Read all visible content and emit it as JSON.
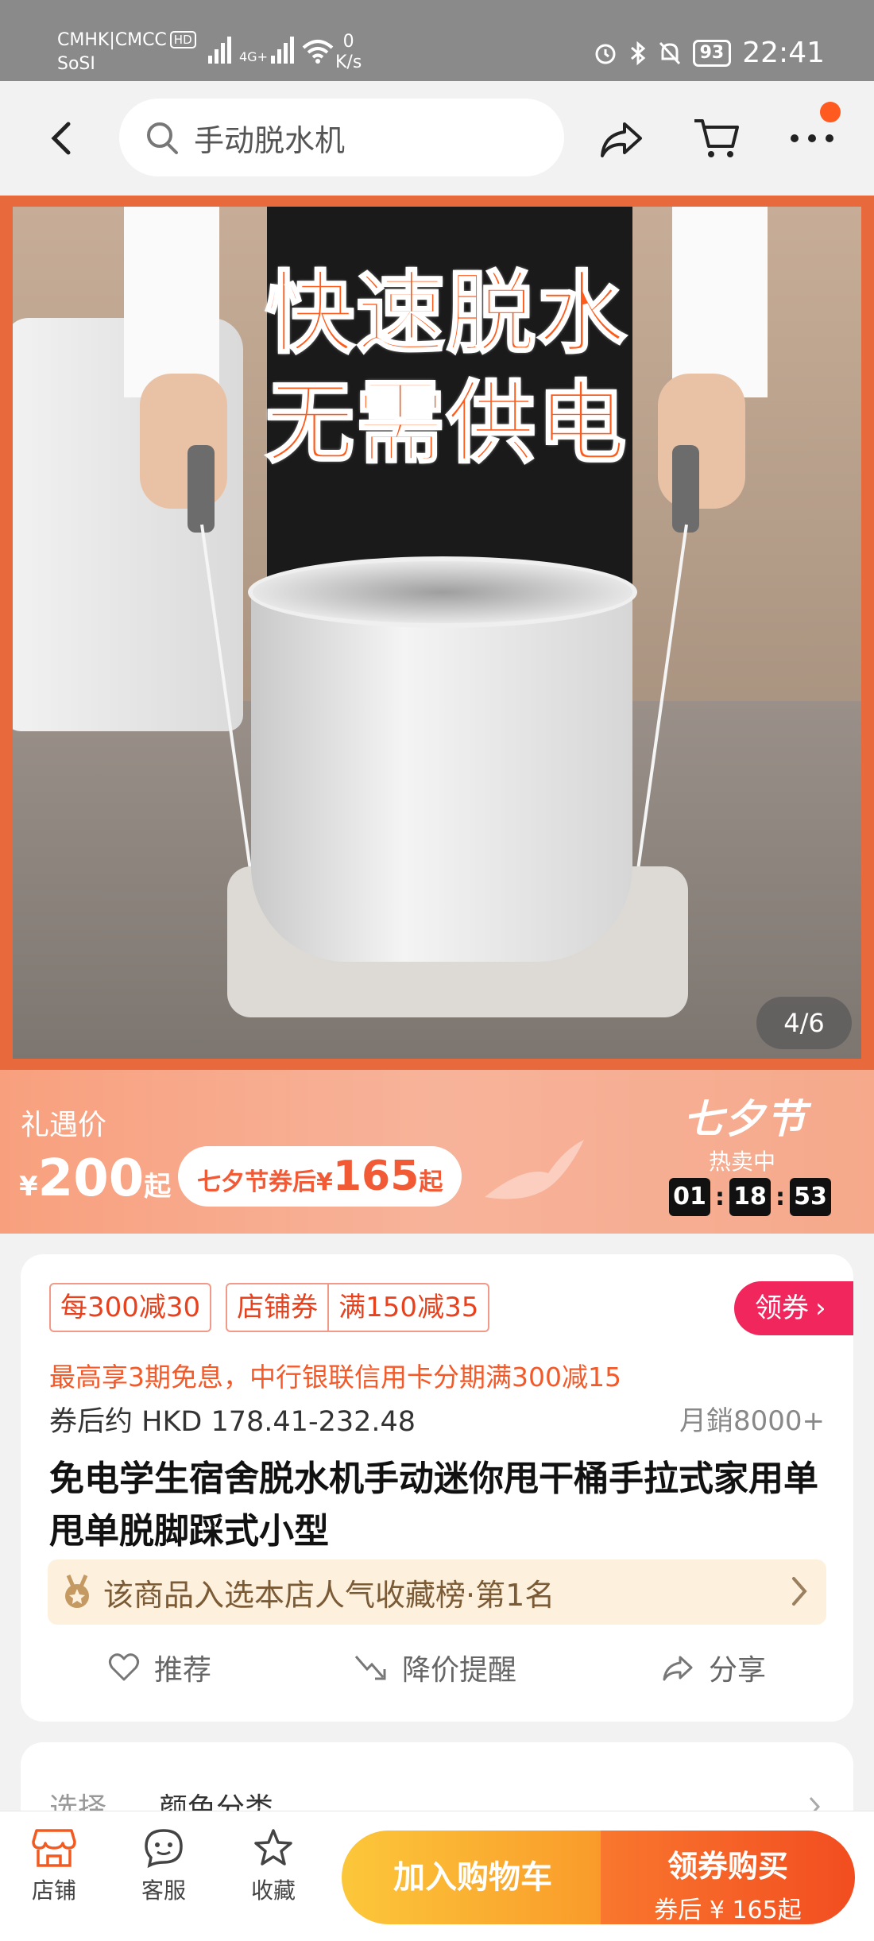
{
  "status_bar": {
    "carrier": "CMHK|CMCC",
    "hd_badge": "HD",
    "carrier2": "SoSI",
    "network": "4G+",
    "speed_value": "0",
    "speed_unit": "K/s",
    "battery": "93",
    "time": "22:41"
  },
  "header": {
    "search_text": "手动脱水机"
  },
  "hero": {
    "headline_line1": "快速脱水",
    "headline_line2": "无需供电",
    "pager": "4/6"
  },
  "price_banner": {
    "label": "礼遇价",
    "currency": "¥",
    "price": "200",
    "suffix": "起",
    "coupon_text": "七夕节券后",
    "coupon_currency": "¥",
    "coupon_price": "165",
    "coupon_suffix": "起",
    "festival": "七夕节",
    "hot_status": "热卖中",
    "countdown": [
      "01",
      "18",
      "53"
    ]
  },
  "info": {
    "tag1": "每300减30",
    "tag2a": "店铺券",
    "tag2b": "满150减35",
    "claim_label": "领券",
    "installment": "最高享3期免息，中行银联信用卡分期满300减15",
    "after_coupon": "券后约 HKD 178.41-232.48",
    "monthly_sales": "月銷8000+",
    "title": "免电学生宿舍脱水机手动迷你甩干桶手拉式家用单甩单脱脚踩式小型",
    "rank": "该商品入选本店人气收藏榜·第1名",
    "actions": {
      "recommend": "推荐",
      "price_alert": "降价提醒",
      "share": "分享"
    }
  },
  "options": {
    "label": "选择",
    "value": "颜色分类"
  },
  "bottom_bar": {
    "shop": "店铺",
    "service": "客服",
    "favorite": "收藏",
    "add_to_cart": "加入购物车",
    "buy_label": "领券购买",
    "buy_sub": "券后 ¥ 165起"
  },
  "colors": {
    "accent": "#f24d20",
    "cart_button": "#fcc73a",
    "price_banner": "#f8a07e",
    "claim_button": "#f0265c"
  }
}
